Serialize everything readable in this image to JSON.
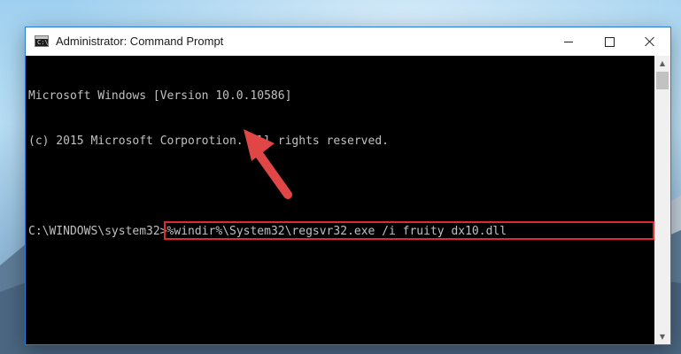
{
  "window": {
    "title": "Administrator: Command Prompt",
    "icon": "cmd-icon",
    "icon_glyph": "C:\\",
    "controls": [
      "minimize-icon",
      "maximize-icon",
      "close-icon"
    ]
  },
  "console": {
    "lines": [
      "Microsoft Windows [Version 10.0.10586]",
      "(c) 2015 Microsoft Corporotion. All rights reserved."
    ],
    "prompt": "C:\\WINDOWS\\system32>",
    "command": "%windir%\\System32\\regsvr32.exe /i fruity dx10.dll"
  },
  "annotation": {
    "highlight_color": "#e02a2a",
    "arrow_color": "#e04646",
    "arrow_icon": "pointer-arrow-icon"
  },
  "scrollbar": {
    "up_icon": "chevron-up-icon",
    "down_icon": "chevron-down-icon"
  }
}
